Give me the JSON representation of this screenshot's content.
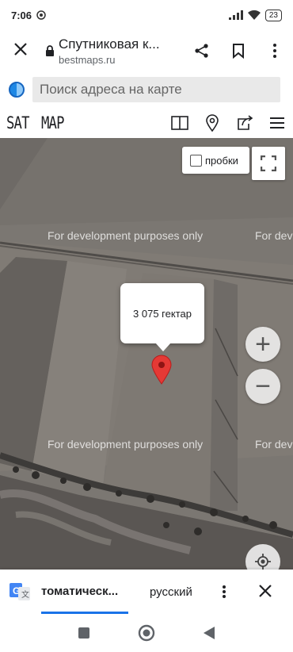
{
  "status_bar": {
    "time": "7:06",
    "battery": "23"
  },
  "browser": {
    "page_title": "Спутниковая к...",
    "url": "bestmaps.ru"
  },
  "search": {
    "placeholder": "Поиск адреса на карте"
  },
  "map_tabs": {
    "sat": "SAT",
    "map": "MAP"
  },
  "map": {
    "traffic_label": "пробки",
    "watermarks": [
      "For development purposes only",
      "For development purposes only",
      "For development purposes only",
      "For development purposes only"
    ],
    "infowindow_text": "3 075 гектар",
    "marker_color": "#e53935",
    "zoom_in": "+",
    "zoom_out": "−"
  },
  "translate_bar": {
    "source_lang": "томатическ...",
    "target_lang": "русский",
    "accent": "#1a73e8"
  },
  "icons": [
    "close-icon",
    "lock-icon",
    "share-icon",
    "bookmark-icon",
    "more-icon",
    "split-view-icon",
    "location-pin-icon",
    "open-external-icon",
    "menu-icon",
    "fullscreen-icon",
    "my-location-icon",
    "google-translate-icon",
    "back-icon",
    "home-icon",
    "recents-icon"
  ]
}
